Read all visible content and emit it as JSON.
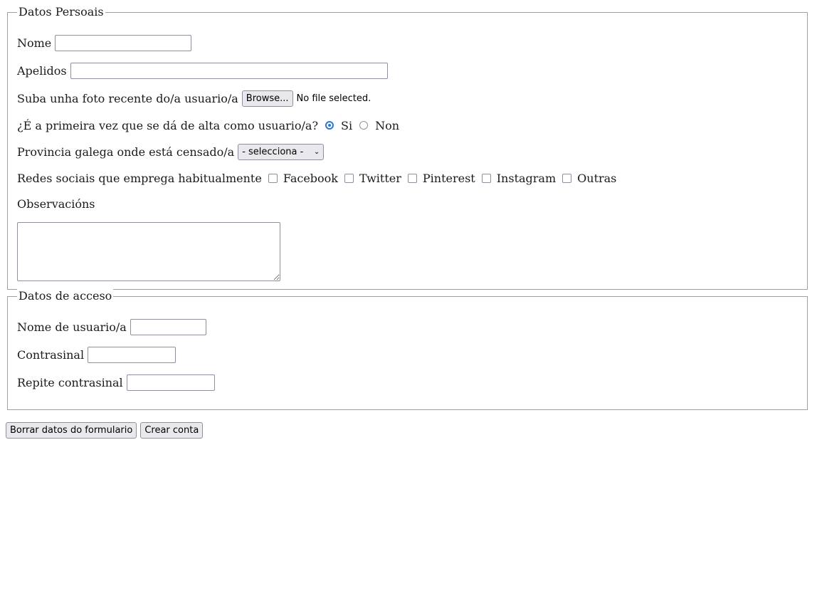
{
  "personal": {
    "legend": "Datos Persoais",
    "nome_label": "Nome",
    "apelidos_label": "Apelidos",
    "foto_label": "Suba unha foto recente do/a usuario/a",
    "browse_label": "Browse...",
    "no_file": "No file selected.",
    "primeira_label": "¿É a primeira vez que se dá de alta como usuario/a?",
    "radio_si": "Si",
    "radio_non": "Non",
    "selected_radio": "Si",
    "provincia_label": "Provincia galega onde está censado/a",
    "provincia_value": "- selecciona -",
    "redes_label": "Redes sociais que emprega habitualmente",
    "redes": [
      "Facebook",
      "Twitter",
      "Pinterest",
      "Instagram",
      "Outras"
    ],
    "observacions_label": "Observacións"
  },
  "access": {
    "legend": "Datos de acceso",
    "usuario_label": "Nome de usuario/a",
    "contrasinal_label": "Contrasinal",
    "repite_label": "Repite contrasinal"
  },
  "buttons": {
    "reset": "Borrar datos do formulario",
    "submit": "Crear conta"
  },
  "colors": {
    "accent": "#2a7ad9",
    "border": "#8f8f9d"
  }
}
